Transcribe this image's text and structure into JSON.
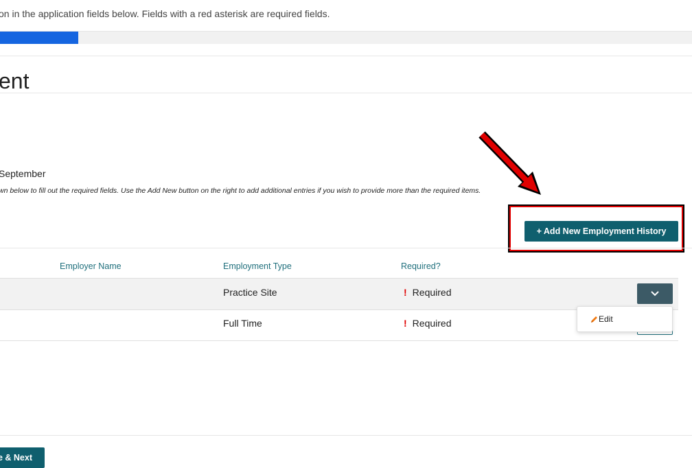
{
  "header": {
    "instructions": "on in the application fields below. Fields with a red asterisk are required fields."
  },
  "progress": {
    "percent": 11.3
  },
  "section": {
    "title": "ent",
    "subheading": "September",
    "help_text": "wn below to fill out the required fields. Use the Add New button on the right to add additional entries if you wish to provide more than the required items."
  },
  "toolbar": {
    "add_label": "+ Add New Employment History"
  },
  "table": {
    "columns": [
      "Employer Name",
      "Employment Type",
      "Required?"
    ],
    "rows": [
      {
        "employer": "",
        "type": "Practice Site",
        "required": "Required"
      },
      {
        "employer": "",
        "type": "Full Time",
        "required": "Required"
      }
    ]
  },
  "row_menu": {
    "items": [
      "Edit"
    ]
  },
  "footer": {
    "next_label": "e & Next"
  },
  "colors": {
    "primary": "#0f5f6e",
    "progress": "#1565e0",
    "required": "#e00000",
    "highlight": "#e00000"
  },
  "icons": {
    "dropdown": "chevron-down-icon",
    "edit": "pencil-icon",
    "annotation": "red-arrow"
  }
}
